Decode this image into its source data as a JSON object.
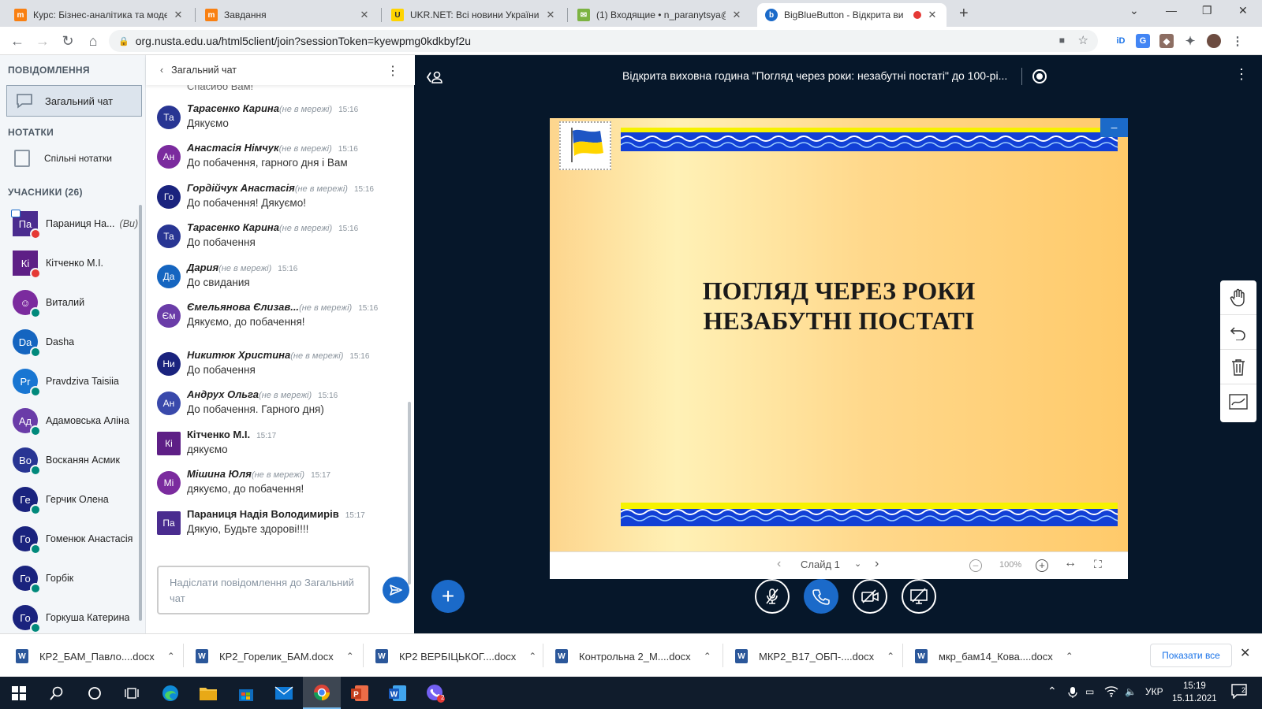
{
  "browser": {
    "tabs": [
      {
        "title": "Курс: Бізнес-аналітика та моделі",
        "favicon": "moodle-icon"
      },
      {
        "title": "Завдання",
        "favicon": "moodle-icon"
      },
      {
        "title": "UKR.NET: Всі новини України, ос",
        "favicon": "ukrnet-icon"
      },
      {
        "title": "(1) Входящие • n_paranytsya@ul",
        "favicon": "mail-icon"
      },
      {
        "title": "BigBlueButton - Відкрита ви",
        "favicon": "bbb-icon",
        "active": true
      }
    ],
    "url": "org.nusta.edu.ua/html5client/join?sessionToken=kyewpmg0kdkbyf2u"
  },
  "userlist": {
    "messages_header": "ПОВІДОМЛЕННЯ",
    "public_chat_label": "Загальний чат",
    "notes_header": "НОТАТКИ",
    "shared_notes_label": "Спільні нотатки",
    "participants_header": "УЧАСНИКИ (26)",
    "users": [
      {
        "initials": "Па",
        "name": "Параниця На...",
        "you": "(Ви)",
        "color": "#4a2c8f",
        "square": true,
        "badge": "#e53935",
        "presenter": true
      },
      {
        "initials": "Кі",
        "name": "Кітченко М.І.",
        "you": "",
        "color": "#5e1f86",
        "square": true,
        "badge": "#e53935",
        "presenter": false
      },
      {
        "initials": "☺",
        "name": "Виталий",
        "you": "",
        "color": "#7b2b9e",
        "square": false,
        "badge": "#00897b",
        "presenter": false
      },
      {
        "initials": "Da",
        "name": "Dasha",
        "you": "",
        "color": "#1565c0",
        "square": false,
        "badge": "#00897b",
        "presenter": false
      },
      {
        "initials": "Pr",
        "name": "Pravdziva Taisiia",
        "you": "",
        "color": "#1976d2",
        "square": false,
        "badge": "#00897b",
        "presenter": false
      },
      {
        "initials": "Ад",
        "name": "Адамовська Аліна",
        "you": "",
        "color": "#6a3ca8",
        "square": false,
        "badge": "#00897b",
        "presenter": false
      },
      {
        "initials": "Во",
        "name": "Восканян Асмик",
        "you": "",
        "color": "#283593",
        "square": false,
        "badge": "#00897b",
        "presenter": false
      },
      {
        "initials": "Ге",
        "name": "Герчик Олена",
        "you": "",
        "color": "#1a237e",
        "square": false,
        "badge": "#00897b",
        "presenter": false
      },
      {
        "initials": "Го",
        "name": "Гоменюк Анастасія",
        "you": "",
        "color": "#1a237e",
        "square": false,
        "badge": "#00897b",
        "presenter": false
      },
      {
        "initials": "Го",
        "name": "Горбік",
        "you": "",
        "color": "#1a237e",
        "square": false,
        "badge": "#00897b",
        "presenter": false
      },
      {
        "initials": "Го",
        "name": "Горкуша Катерина",
        "you": "",
        "color": "#1a237e",
        "square": false,
        "badge": "#00897b",
        "presenter": false
      }
    ]
  },
  "chat": {
    "title": "Загальний чат",
    "partial_top": "Спасибо Вам!",
    "input_placeholder": "Надіслати повідомлення до Загальний чат",
    "messages": [
      {
        "initials": "Та",
        "name": "Тарасенко Карина",
        "offline": "(не в мережі)",
        "time": "15:16",
        "text": "Дякуємо",
        "color": "#283593"
      },
      {
        "initials": "Ан",
        "name": "Анастасія Німчук",
        "offline": "(не в мережі)",
        "time": "15:16",
        "text": "До побачення, гарного дня і Вам",
        "color": "#7b2b9e"
      },
      {
        "initials": "Го",
        "name": "Гордійчук Анастасія",
        "offline": "(не в мережі)",
        "time": "15:16",
        "text": "До побачення! Дякуємо!",
        "color": "#1a237e"
      },
      {
        "initials": "Та",
        "name": "Тарасенко Карина",
        "offline": "(не в мережі)",
        "time": "15:16",
        "text": "До побачення",
        "color": "#283593"
      },
      {
        "initials": "Да",
        "name": "Дария",
        "offline": "(не в мережі)",
        "time": "15:16",
        "text": "До свидания",
        "color": "#1565c0"
      },
      {
        "initials": "Єм",
        "name": "Ємельянова Єлизав...",
        "offline": "(не в мережі)",
        "time": "15:16",
        "text": "Дякуємо, до побачення!",
        "color": "#6a3ca8"
      },
      {
        "initials": "Ни",
        "name": "Никитюк Христина",
        "offline": "(не в мережі)",
        "time": "15:16",
        "text": "До побачення",
        "color": "#1a237e"
      },
      {
        "initials": "Ан",
        "name": "Андрух Ольга",
        "offline": "(не в мережі)",
        "time": "15:16",
        "text": "До побачення. Гарного дня)",
        "color": "#3949ab"
      },
      {
        "initials": "Кі",
        "name": "Кітченко М.І.",
        "offline": "",
        "time": "15:17",
        "text": "дякуємо",
        "color": "#5e1f86",
        "square": true
      },
      {
        "initials": "Мі",
        "name": "Мішина Юля",
        "offline": "(не в мережі)",
        "time": "15:17",
        "text": "дякуємо, до побачення!",
        "color": "#7b2b9e"
      },
      {
        "initials": "Па",
        "name": "Параниця Надія Володимирів",
        "offline": "",
        "time": "15:17",
        "text": "Дякую, Будьте здорові!!!!",
        "color": "#4a2c8f",
        "square": true
      }
    ]
  },
  "presentation": {
    "meeting_title": "Відкрита виховна година \"Погляд через роки: незабутні постаті\" до 100-рі...",
    "slide_title_line1": "ПОГЛЯД ЧЕРЕЗ РОКИ",
    "slide_title_line2": "НЕЗАБУТНІ ПОСТАТІ",
    "slide_label": "Слайд 1",
    "zoom": "100%",
    "minimize_label": "–"
  },
  "downloads": {
    "files": [
      "КР2_БАМ_Павло....docx",
      "КР2_Горелик_БАМ.docx",
      "КР2 ВЕРБІЦЬКОГ....docx",
      "Контрольна 2_М....docx",
      "МКР2_В17_ОБП-....docx",
      "мкр_бам14_Кова....docx"
    ],
    "show_all": "Показати все"
  },
  "taskbar": {
    "language": "УКР",
    "time": "15:19",
    "date": "15.11.2021",
    "notifications": "2",
    "viber_badge": "2"
  },
  "colors": {
    "bbb_blue": "#1b6ac9",
    "bbb_dark": "#06172a",
    "sidebar_bg": "#f3f6f9"
  }
}
